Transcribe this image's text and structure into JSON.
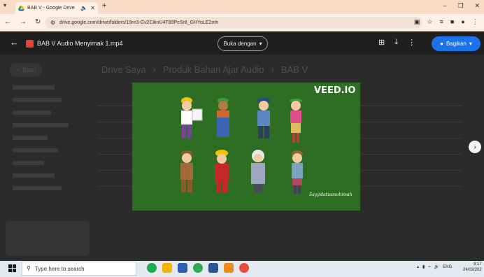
{
  "browser": {
    "tab_title": "BAB V - Google Drive",
    "tab_audio_icon": "speaker-icon",
    "new_tab": "+",
    "url": "drive.google.com/drive/folders/19nr3-Gv2CiknU4T89PcSr8_GHYoLE2mh"
  },
  "viewer": {
    "file_name": "BAB V Audio Menyimak 1.mp4",
    "open_with_label": "Buka dengan",
    "share_label": "Bagikan"
  },
  "background": {
    "breadcrumb": [
      "Drive Saya",
      "Produk Bahan Ajar Audio",
      "BAB V"
    ],
    "new_button": "Baru"
  },
  "video": {
    "watermark": "VEED.IO",
    "signature": "Sayyidatusmohimah"
  },
  "taskbar": {
    "search_placeholder": "Type here to search",
    "language": "ENG",
    "time": "9:17",
    "date": "24/03/202"
  },
  "colors": {
    "video_green": "#2e6e22",
    "share_blue": "#1a73e8",
    "tab_strip": "#f9dcc8"
  }
}
